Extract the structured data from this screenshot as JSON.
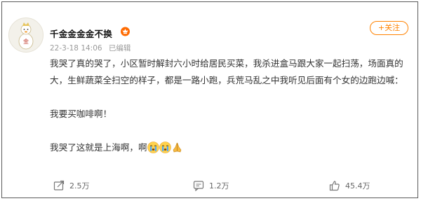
{
  "post": {
    "username": "千金金金金不换",
    "badge_icon": "crown-badge-icon",
    "time": "22-3-18 14:06",
    "edited": "已编辑",
    "follow_label": "+关注",
    "paragraphs": [
      "我哭了真的哭了，小区暂时解封六小时给居民买菜，我杀进盒马跟大家一起扫荡，场面真的大，生鲜蔬菜全扫空的样子，都是一路小跑，兵荒马乱之中我听见后面有个女的边跑边喊：",
      "我要买咖啡啊！",
      "我哭了这就是上海啊，啊"
    ],
    "emojis": [
      "crying-face-icon",
      "crying-face-icon",
      "praying-hands-icon"
    ]
  },
  "footer": {
    "shares": "2.5万",
    "comments": "1.2万",
    "likes": "45.4万"
  },
  "colors": {
    "accent": "#ff8200",
    "text": "#333333",
    "meta": "#9a9a9a"
  }
}
